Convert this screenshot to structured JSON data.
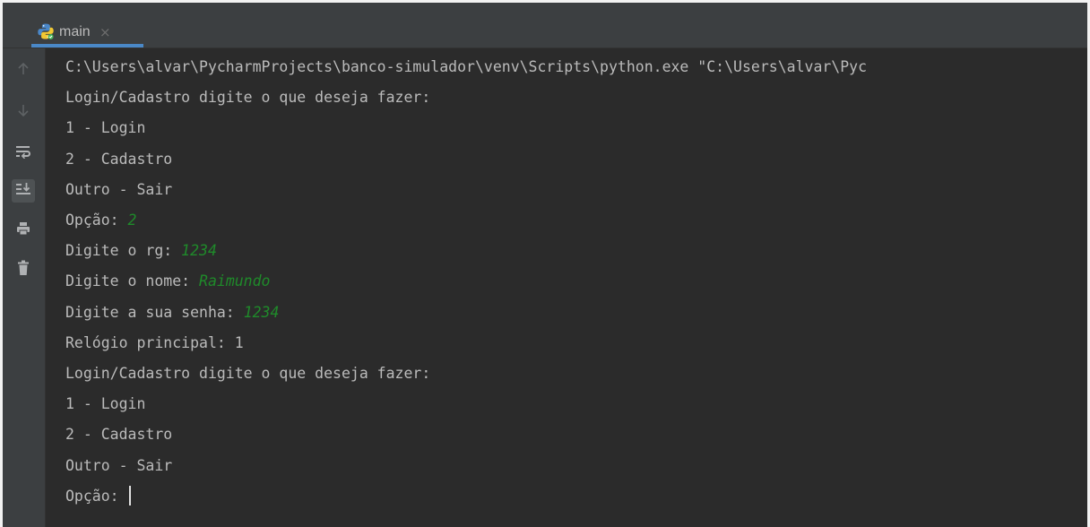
{
  "tab": {
    "label": "main",
    "close_glyph": "×",
    "icon": "python-icon"
  },
  "toolbar": {
    "buttons": [
      {
        "icon": "up-arrow-icon",
        "label": "Up the stack trace"
      },
      {
        "icon": "down-arrow-icon",
        "label": "Down the stack trace"
      },
      {
        "icon": "soft-wrap-icon",
        "label": "Soft-wrap"
      },
      {
        "icon": "scroll-to-end-icon",
        "label": "Scroll to the end",
        "active": true
      },
      {
        "icon": "print-icon",
        "label": "Print"
      },
      {
        "icon": "trash-icon",
        "label": "Clear all"
      }
    ]
  },
  "console": {
    "lines": [
      {
        "text": "C:\\Users\\alvar\\PycharmProjects\\banco-simulador\\venv\\Scripts\\python.exe \"C:\\Users\\alvar\\Pyc",
        "input": ""
      },
      {
        "text": "Login/Cadastro digite o que deseja fazer:",
        "input": ""
      },
      {
        "text": "1 - Login",
        "input": ""
      },
      {
        "text": "2 - Cadastro",
        "input": ""
      },
      {
        "text": "Outro - Sair",
        "input": ""
      },
      {
        "text": "Opção: ",
        "input": "2"
      },
      {
        "text": "Digite o rg: ",
        "input": "1234"
      },
      {
        "text": "Digite o nome: ",
        "input": "Raimundo"
      },
      {
        "text": "Digite a sua senha: ",
        "input": "1234"
      },
      {
        "text": "Relógio principal: 1",
        "input": ""
      },
      {
        "text": "Login/Cadastro digite o que deseja fazer:",
        "input": ""
      },
      {
        "text": "1 - Login",
        "input": ""
      },
      {
        "text": "2 - Cadastro",
        "input": ""
      },
      {
        "text": "Outro - Sair",
        "input": ""
      },
      {
        "text": "Opção: ",
        "input": ""
      }
    ]
  },
  "colors": {
    "background": "#2b2b2b",
    "text": "#bbbbbb",
    "user_input": "#1f8a2a",
    "tab_underline": "#4a88c7"
  }
}
